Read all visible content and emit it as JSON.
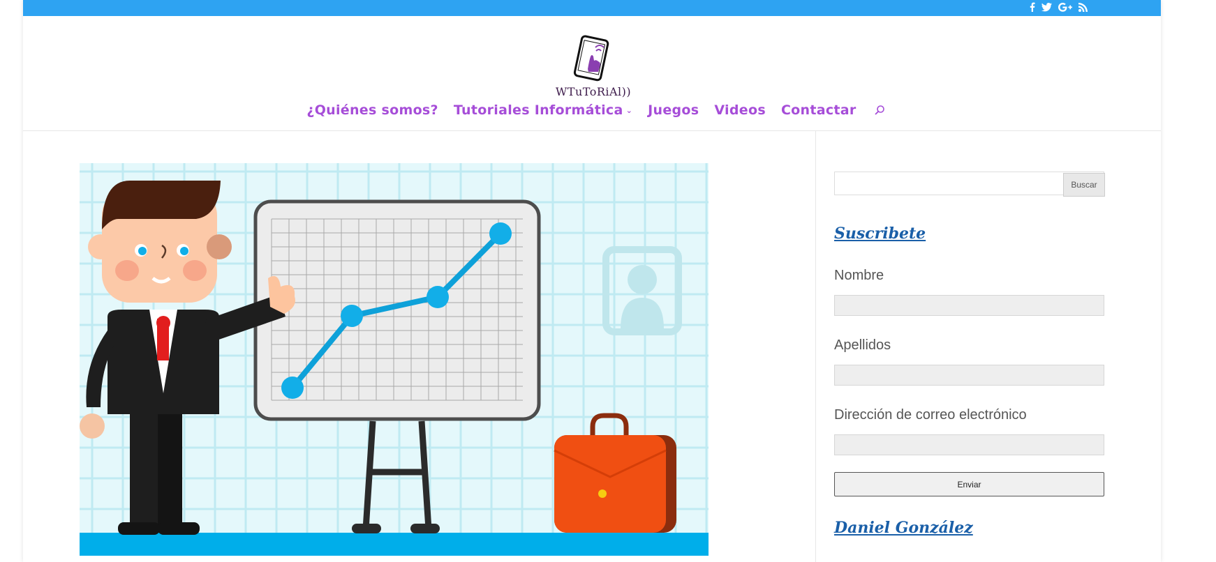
{
  "header": {
    "logo_text": "WTuToRiAl))",
    "social_icons": [
      "facebook-icon",
      "twitter-icon",
      "google-plus-icon",
      "rss-icon"
    ]
  },
  "nav": {
    "items": [
      {
        "label": "¿Quiénes somos?"
      },
      {
        "label": "Tutoriales Informática",
        "has_submenu": true
      },
      {
        "label": "Juegos"
      },
      {
        "label": "Videos"
      },
      {
        "label": "Contactar"
      }
    ],
    "search_icon": "search-icon"
  },
  "sidebar": {
    "search_button": "Buscar",
    "subscribe_title": "Suscribete",
    "fields": [
      {
        "label": "Nombre"
      },
      {
        "label": "Apellidos"
      },
      {
        "label": "Dirección de correo electrónico"
      }
    ],
    "send_button": "Enviar",
    "author_title": "Daniel González"
  },
  "colors": {
    "topbar": "#2ea3f2",
    "nav_text": "#a64dd8",
    "widget_title": "#1a5fa8"
  }
}
